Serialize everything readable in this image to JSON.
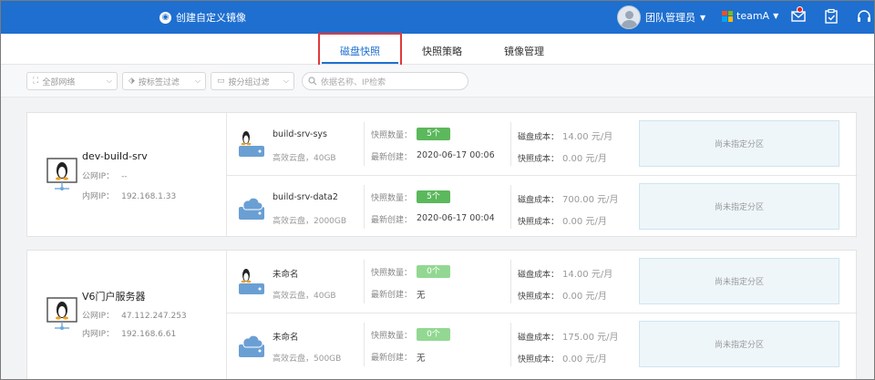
{
  "header": {
    "create_image": "创建自定义镜像",
    "user_label": "团队管理员",
    "team_label": "teamA"
  },
  "tabs": [
    {
      "label": "磁盘快照",
      "active": true
    },
    {
      "label": "快照策略",
      "active": false
    },
    {
      "label": "镜像管理",
      "active": false
    }
  ],
  "filters": {
    "network": "全部网络",
    "tag": "按标签过滤",
    "group": "按分组过滤",
    "search_placeholder": "依据名称、IP检索"
  },
  "labels": {
    "public_ip": "公网IP：",
    "private_ip": "内网IP：",
    "snapshot_count": "快照数量：",
    "latest_created": "最新创建：",
    "disk_cost": "磁盘成本：",
    "snapshot_cost": "快照成本：",
    "zone_unassigned": "尚未指定分区"
  },
  "colors": {
    "primary": "#1e6fd0",
    "green": "#5cb85c",
    "light_green": "#92d892",
    "highlight": "#e03a3a"
  },
  "hosts": [
    {
      "name": "dev-build-srv",
      "public_ip": "--",
      "private_ip": "192.168.1.33",
      "disks": [
        {
          "name": "build-srv-sys",
          "type": "高效云盘，40GB",
          "count": "5个",
          "created": "2020-06-17 00:06",
          "disk_cost": "14.00 元/月",
          "snapshot_cost": "0.00 元/月",
          "icon": "linux-disk-icon"
        },
        {
          "name": "build-srv-data2",
          "type": "高效云盘，2000GB",
          "count": "5个",
          "created": "2020-06-17 00:04",
          "disk_cost": "700.00 元/月",
          "snapshot_cost": "0.00 元/月",
          "icon": "data-disk-icon"
        }
      ]
    },
    {
      "name": "V6门户服务器",
      "public_ip": "47.112.247.253",
      "private_ip": "192.168.6.61",
      "disks": [
        {
          "name": "未命名",
          "type": "高效云盘，40GB",
          "count": "0个",
          "created": "无",
          "disk_cost": "14.00 元/月",
          "snapshot_cost": "0.00 元/月",
          "icon": "linux-disk-icon"
        },
        {
          "name": "未命名",
          "type": "高效云盘，500GB",
          "count": "0个",
          "created": "无",
          "disk_cost": "175.00 元/月",
          "snapshot_cost": "0.00 元/月",
          "icon": "data-disk-icon"
        }
      ]
    }
  ]
}
